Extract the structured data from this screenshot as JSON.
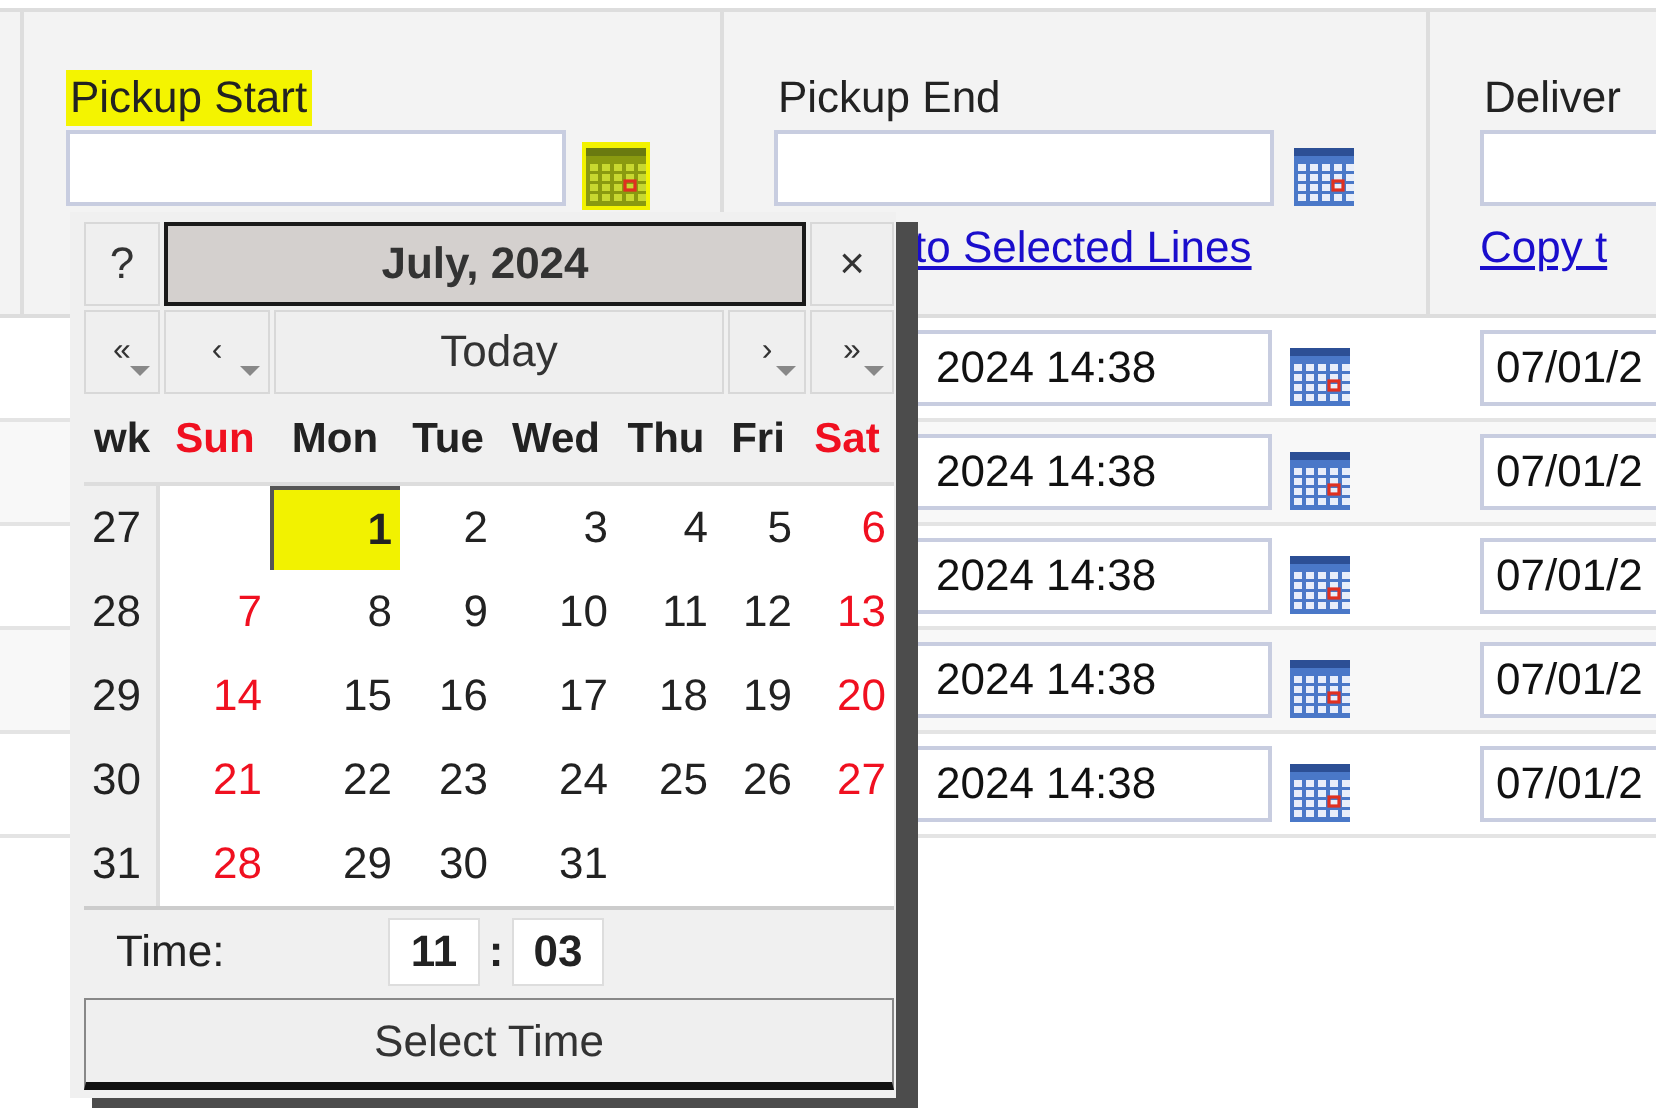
{
  "header": {
    "columns": [
      {
        "label": "Pickup Start",
        "highlighted": true,
        "icon": {
          "highlighted": true
        }
      },
      {
        "label": "Pickup End",
        "highlighted": false,
        "icon": {
          "highlighted": false
        },
        "link": "to Selected Lines"
      },
      {
        "label": "Deliver",
        "highlighted": false,
        "link": "Copy t"
      }
    ]
  },
  "rows": [
    {
      "pickup_end": "2024 14:38",
      "delivery": "07/01/2"
    },
    {
      "pickup_end": "2024 14:38",
      "delivery": "07/01/2"
    },
    {
      "pickup_end": "2024 14:38",
      "delivery": "07/01/2"
    },
    {
      "pickup_end": "2024 14:38",
      "delivery": "07/01/2"
    },
    {
      "pickup_end": "2024 14:38",
      "delivery": "07/01/2"
    }
  ],
  "calendar": {
    "help": "?",
    "title": "July, 2024",
    "close": "×",
    "nav": [
      "«",
      "‹",
      "Today",
      "›",
      "»"
    ],
    "wk_label": "wk",
    "weekdays": [
      {
        "label": "Sun",
        "weekend": true
      },
      {
        "label": "Mon",
        "weekend": false
      },
      {
        "label": "Tue",
        "weekend": false
      },
      {
        "label": "Wed",
        "weekend": false
      },
      {
        "label": "Thu",
        "weekend": false
      },
      {
        "label": "Fri",
        "weekend": false
      },
      {
        "label": "Sat",
        "weekend": true
      }
    ],
    "weeks": [
      {
        "number": "27",
        "days": [
          {
            "kind": "blank"
          },
          {
            "kind": "day",
            "text": "1",
            "weekend": false,
            "selected": true
          },
          {
            "kind": "day",
            "text": "2",
            "weekend": false,
            "selected": false
          },
          {
            "kind": "day",
            "text": "3",
            "weekend": false,
            "selected": false
          },
          {
            "kind": "day",
            "text": "4",
            "weekend": false,
            "selected": false
          },
          {
            "kind": "day",
            "text": "5",
            "weekend": false,
            "selected": false
          },
          {
            "kind": "day",
            "text": "6",
            "weekend": true,
            "selected": false
          }
        ]
      },
      {
        "number": "28",
        "days": [
          {
            "kind": "day",
            "text": "7",
            "weekend": true,
            "selected": false
          },
          {
            "kind": "day",
            "text": "8",
            "weekend": false,
            "selected": false
          },
          {
            "kind": "day",
            "text": "9",
            "weekend": false,
            "selected": false
          },
          {
            "kind": "day",
            "text": "10",
            "weekend": false,
            "selected": false
          },
          {
            "kind": "day",
            "text": "11",
            "weekend": false,
            "selected": false
          },
          {
            "kind": "day",
            "text": "12",
            "weekend": false,
            "selected": false
          },
          {
            "kind": "day",
            "text": "13",
            "weekend": true,
            "selected": false
          }
        ]
      },
      {
        "number": "29",
        "days": [
          {
            "kind": "day",
            "text": "14",
            "weekend": true,
            "selected": false
          },
          {
            "kind": "day",
            "text": "15",
            "weekend": false,
            "selected": false
          },
          {
            "kind": "day",
            "text": "16",
            "weekend": false,
            "selected": false
          },
          {
            "kind": "day",
            "text": "17",
            "weekend": false,
            "selected": false
          },
          {
            "kind": "day",
            "text": "18",
            "weekend": false,
            "selected": false
          },
          {
            "kind": "day",
            "text": "19",
            "weekend": false,
            "selected": false
          },
          {
            "kind": "day",
            "text": "20",
            "weekend": true,
            "selected": false
          }
        ]
      },
      {
        "number": "30",
        "days": [
          {
            "kind": "day",
            "text": "21",
            "weekend": true,
            "selected": false
          },
          {
            "kind": "day",
            "text": "22",
            "weekend": false,
            "selected": false
          },
          {
            "kind": "day",
            "text": "23",
            "weekend": false,
            "selected": false
          },
          {
            "kind": "day",
            "text": "24",
            "weekend": false,
            "selected": false
          },
          {
            "kind": "day",
            "text": "25",
            "weekend": false,
            "selected": false
          },
          {
            "kind": "day",
            "text": "26",
            "weekend": false,
            "selected": false
          },
          {
            "kind": "day",
            "text": "27",
            "weekend": true,
            "selected": false
          }
        ]
      },
      {
        "number": "31",
        "days": [
          {
            "kind": "day",
            "text": "28",
            "weekend": true,
            "selected": false
          },
          {
            "kind": "day",
            "text": "29",
            "weekend": false,
            "selected": false
          },
          {
            "kind": "day",
            "text": "30",
            "weekend": false,
            "selected": false
          },
          {
            "kind": "day",
            "text": "31",
            "weekend": false,
            "selected": false
          }
        ]
      }
    ],
    "time": {
      "label": "Time:",
      "hours": "11",
      "separator": ":",
      "minutes": "03"
    },
    "button": "Select Time"
  }
}
